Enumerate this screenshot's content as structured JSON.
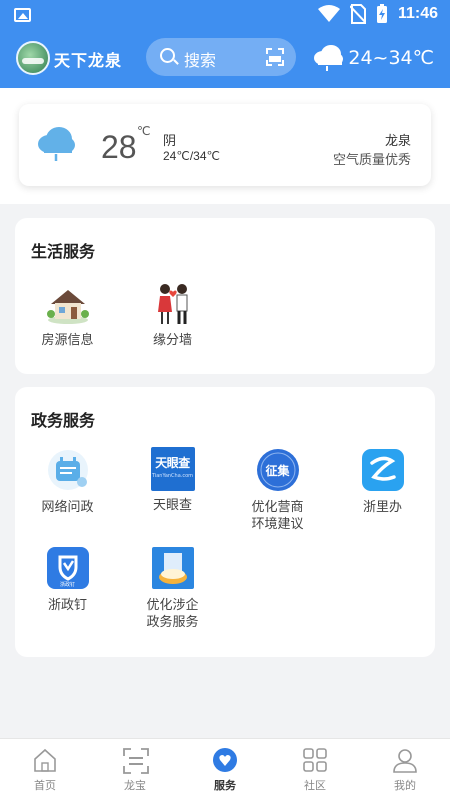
{
  "status_bar": {
    "time": "11:46"
  },
  "header": {
    "brand": "天下龙泉",
    "search_placeholder": "搜索",
    "weather_range": "24~34℃"
  },
  "weather_card": {
    "temp": "28",
    "unit": "℃",
    "condition": "阴",
    "range": "24℃/34℃",
    "city": "龙泉",
    "air_quality": "空气质量优秀"
  },
  "life_services": {
    "title": "生活服务",
    "items": [
      {
        "label": "房源信息",
        "icon": "house-icon"
      },
      {
        "label": "缘分墙",
        "icon": "couple-icon"
      }
    ]
  },
  "gov_services": {
    "title": "政务服务",
    "items": [
      {
        "label": "网络问政",
        "icon": "chat-bot-icon"
      },
      {
        "label": "天眼查",
        "icon": "tianyancha-icon",
        "badge": "天眼查",
        "sub": "TianYanCha.com"
      },
      {
        "label1": "优化营商",
        "label2": "环境建议",
        "icon": "collect-icon",
        "badge": "征集"
      },
      {
        "label": "浙里办",
        "icon": "zheliban-icon"
      },
      {
        "label": "浙政钉",
        "icon": "zhezhengding-icon",
        "sub": "浙政钉"
      },
      {
        "label1": "优化涉企",
        "label2": "政务服务",
        "icon": "enterprise-icon"
      }
    ]
  },
  "bottom_nav": [
    {
      "label": "首页",
      "icon": "home-icon"
    },
    {
      "label": "龙宝",
      "icon": "scan-frame-icon"
    },
    {
      "label": "服务",
      "icon": "service-heart-icon",
      "active": true
    },
    {
      "label": "社区",
      "icon": "grid-icon"
    },
    {
      "label": "我的",
      "icon": "user-icon"
    }
  ],
  "colors": {
    "primary": "#3f8ff0",
    "tianyancha": "#1f6fd1",
    "zheliban": "#2aa2f0"
  }
}
